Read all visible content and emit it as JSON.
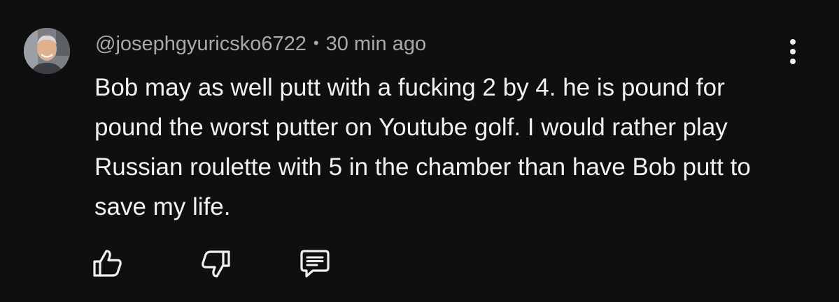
{
  "comment": {
    "author": "@josephgyuricsko6722",
    "separator": "•",
    "timestamp": "30 min ago",
    "text": "Bob may as well putt with a fucking 2 by 4. he is pound for pound the worst putter on Youtube golf. I would rather play Russian roulette with 5 in the chamber than have Bob putt to save my life."
  },
  "icons": {
    "avatar": "avatar-photo",
    "menu": "more-vertical-icon",
    "like": "thumbs-up-icon",
    "dislike": "thumbs-down-icon",
    "reply": "reply-comment-icon"
  },
  "colors": {
    "background": "#0f0f0f",
    "text": "#f1f1f1",
    "meta": "#aaaaaa"
  }
}
